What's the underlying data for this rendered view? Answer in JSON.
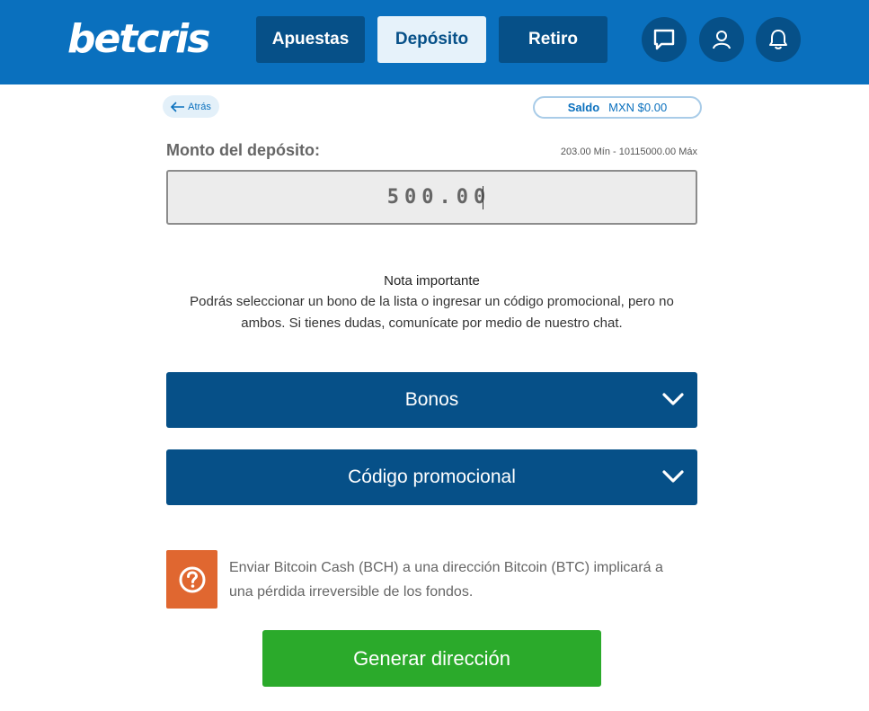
{
  "header": {
    "logo": "betcris",
    "nav": {
      "apuestas": "Apuestas",
      "deposito": "Depósito",
      "retiro": "Retiro"
    },
    "icons": [
      "chat-icon",
      "user-icon",
      "bell-icon"
    ]
  },
  "back": {
    "label": "Atrás"
  },
  "saldo": {
    "label": "Saldo",
    "value": "MXN $0.00"
  },
  "deposit": {
    "label": "Monto del depósito:",
    "limits": "203.00 Mín - 10115000.00 Máx",
    "amount": "500.00"
  },
  "nota": {
    "title": "Nota importante",
    "body": "Podrás seleccionar un bono de la lista o ingresar un código promocional, pero no ambos. Si tienes dudas, comunícate por medio de nuestro chat."
  },
  "accordions": {
    "bonos": "Bonos",
    "codigo": "Código promocional"
  },
  "warning": {
    "text": "Enviar Bitcoin Cash (BCH) a una dirección Bitcoin (BTC) implicará a una pérdida irreversible de los fondos."
  },
  "generate": {
    "label": "Generar dirección"
  },
  "colors": {
    "header": "#0a70be",
    "dark_blue": "#065088",
    "warning": "#e06730",
    "green": "#2baa2b"
  }
}
